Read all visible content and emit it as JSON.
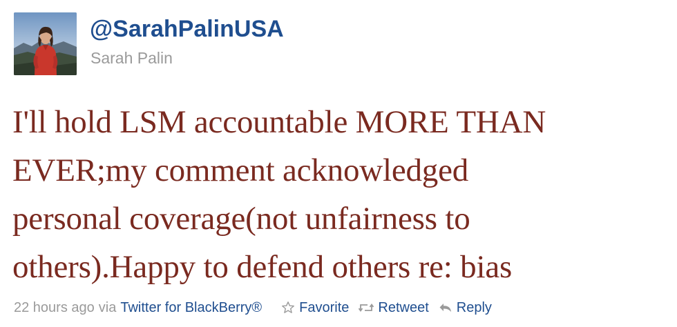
{
  "user": {
    "handle": "@SarahPalinUSA",
    "name": "Sarah Palin",
    "avatar_icon": "profile-photo"
  },
  "tweet": {
    "lines": [
      "I'll hold LSM accountable MORE THAN",
      "EVER;my comment acknowledged",
      "personal coverage(not unfairness to",
      "others).Happy to defend others re: bias"
    ]
  },
  "meta": {
    "time": "22 hours ago",
    "via": "via",
    "source": "Twitter for BlackBerry®"
  },
  "actions": {
    "favorite": {
      "label": "Favorite",
      "icon": "star-outline-icon"
    },
    "retweet": {
      "label": "Retweet",
      "icon": "retweet-icon"
    },
    "reply": {
      "label": "Reply",
      "icon": "reply-arrow-icon"
    }
  },
  "colors": {
    "link": "#1f4e8f",
    "tweet_text": "#7a2a20",
    "muted": "#9a9a9a"
  }
}
